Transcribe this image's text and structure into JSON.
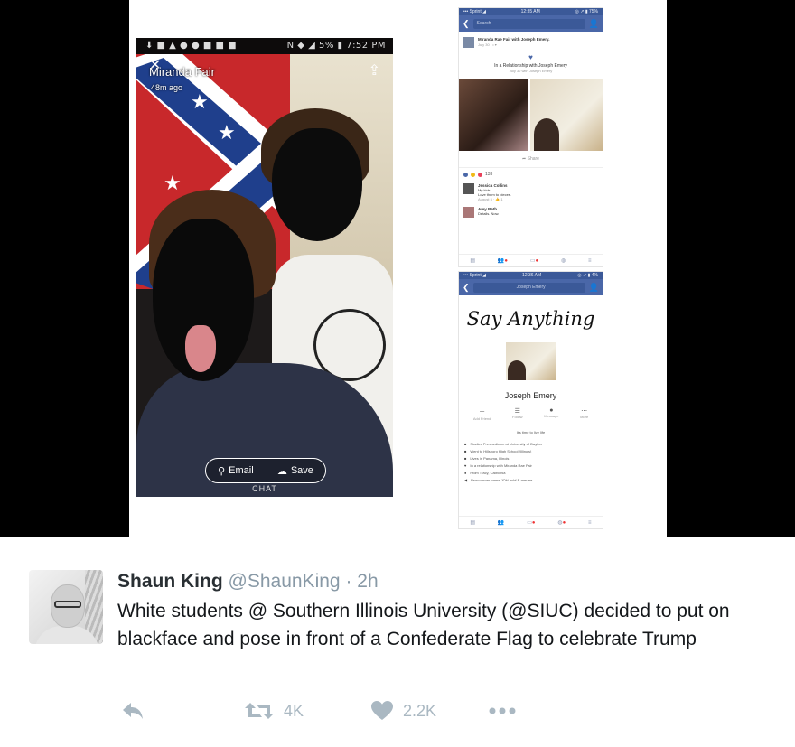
{
  "snapchat": {
    "status_left": "⬇ ■ ▲ ● ● ■ ■ ■",
    "status_right": "N ◆ ◢ 5% ▮ 7:52 PM",
    "sender_name": "Miranda Fair",
    "time_ago": "48m ago",
    "email_label": "Email",
    "save_label": "Save",
    "chat_label": "CHAT"
  },
  "fb_post": {
    "status_left": "••• Sprint ◢",
    "status_time": "12:35 AM",
    "status_right": "◎ ↗ ▮ 75%",
    "search_placeholder": "Search",
    "post_title": "Miranda Rae Fair with Joseph Emery.",
    "post_meta": "July 30 · • ▾",
    "relationship": "In a Relationship with Joseph Emery",
    "relationship_sub": "July 30 with Joseph Emery",
    "share_label": "Share",
    "reaction_count": "133",
    "comment1_name": "Jessica Collins",
    "comment1_line1": "My kids.",
    "comment1_line2": "Love them to pieces.",
    "comment1_meta": "August 5 · 👍 1",
    "comment2_name": "Amy Beth",
    "comment2_line1": "Details. Now."
  },
  "fb_profile": {
    "status_left": "••• Sprint ◢",
    "status_time": "12:36 AM",
    "status_right": "◎ ↗ ▮ 4%",
    "search_text": "Joseph Emery",
    "cover_text": "Say Anything",
    "name": "Joseph Emery",
    "actions": [
      "Add Friend",
      "Follow",
      "Message",
      "More"
    ],
    "bio": "It's time to live life",
    "info": [
      "Studies Pre-medicine at University of Dayton",
      "Went to Hillsboro High School (Illinois)",
      "Lives in Panama, Illinois",
      "In a relationship with Miranda Rae Fair",
      "From Tracy, California",
      "Pronounces name JOH-zuhf E-mer-ee"
    ]
  },
  "tweet": {
    "author_name": "Shaun King",
    "author_handle": "@ShaunKing",
    "separator": "·",
    "time": "2h",
    "text": "White students @ Southern Illinois University (@SIUC) decided to put on blackface and pose in front of a Confederate Flag to celebrate Trump",
    "retweet_count": "4K",
    "like_count": "2.2K"
  },
  "colors": {
    "facebook_blue": "#3b5998",
    "twitter_gray": "#aab8c2",
    "flag_red": "#c8282b",
    "flag_blue": "#1f3f8c"
  }
}
